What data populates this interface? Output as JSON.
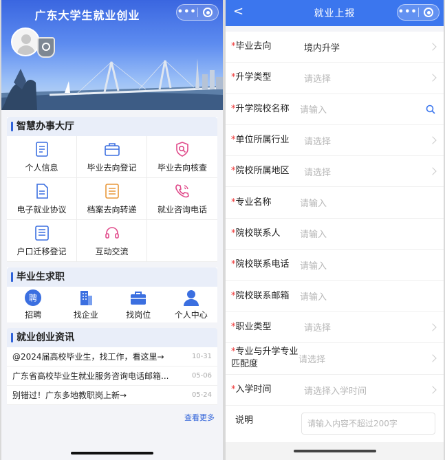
{
  "left": {
    "title": "广东大学生就业创业",
    "services_title": "智慧办事大厅",
    "services": [
      {
        "label": "个人信息",
        "icon": "document-icon"
      },
      {
        "label": "毕业去向登记",
        "icon": "briefcase-icon"
      },
      {
        "label": "毕业去向核查",
        "icon": "shield-search-icon"
      },
      {
        "label": "电子就业协议",
        "icon": "file-text-icon"
      },
      {
        "label": "档案去向转递",
        "icon": "archive-icon"
      },
      {
        "label": "就业咨询电话",
        "icon": "phone-icon"
      },
      {
        "label": "户口迁移登记",
        "icon": "list-icon"
      },
      {
        "label": "互动交流",
        "icon": "headset-icon"
      }
    ],
    "jobs_title": "毕业生求职",
    "jobs": [
      {
        "label": "招聘",
        "icon": "recruit-icon",
        "glyph": "聘"
      },
      {
        "label": "找企业",
        "icon": "building-icon"
      },
      {
        "label": "找岗位",
        "icon": "briefcase-icon"
      },
      {
        "label": "个人中心",
        "icon": "person-icon"
      }
    ],
    "news_title": "就业创业资讯",
    "news": [
      {
        "title": "@2024届高校毕业生，找工作，看这里→",
        "date": "10-31"
      },
      {
        "title": "广东省高校毕业生就业服务咨询电话邮箱...",
        "date": "05-06"
      },
      {
        "title": "别错过！广东多地教职岗上新→",
        "date": "05-24"
      }
    ],
    "more": "查看更多"
  },
  "right": {
    "title": "就业上报",
    "fields": [
      {
        "label": "毕业去向",
        "required": "*",
        "value": "境内升学",
        "placeholder": false,
        "control": "chevron"
      },
      {
        "label": "升学类型",
        "required": "*",
        "value": "请选择",
        "placeholder": true,
        "control": "chevron"
      },
      {
        "label": "升学院校名称",
        "required": "*",
        "value": "请输入",
        "placeholder": true,
        "control": "search"
      },
      {
        "label": "单位所属行业",
        "required": "*",
        "value": "请选择",
        "placeholder": true,
        "control": "chevron"
      },
      {
        "label": "院校所属地区",
        "required": "*",
        "value": "请选择",
        "placeholder": true,
        "control": "chevron"
      },
      {
        "label": "专业名称",
        "required": "*",
        "value": "请输入",
        "placeholder": true,
        "control": "none"
      },
      {
        "label": "院校联系人",
        "required": "*",
        "value": "请输入",
        "placeholder": true,
        "control": "none"
      },
      {
        "label": "院校联系电话",
        "required": "*",
        "value": "请输入",
        "placeholder": true,
        "control": "none"
      },
      {
        "label": "院校联系邮箱",
        "required": "*",
        "value": "请输入",
        "placeholder": true,
        "control": "none"
      },
      {
        "label": "职业类型",
        "required": "*",
        "value": "请选择",
        "placeholder": true,
        "control": "chevron"
      },
      {
        "label": "专业与升学专业匹配度",
        "required": "*",
        "value": "请选择",
        "placeholder": true,
        "control": "chevron"
      },
      {
        "label": "入学时间",
        "required": "*",
        "value": "请选择入学时间",
        "placeholder": true,
        "control": "chevron"
      }
    ],
    "note_label": "说明",
    "note_placeholder": "请输入内容不超过200字"
  },
  "colors": {
    "primary": "#3b76ee",
    "required": "#e33333",
    "icon_blue": "#3b6fe0",
    "icon_orange": "#e8973a",
    "icon_pink": "#e04a8a"
  }
}
